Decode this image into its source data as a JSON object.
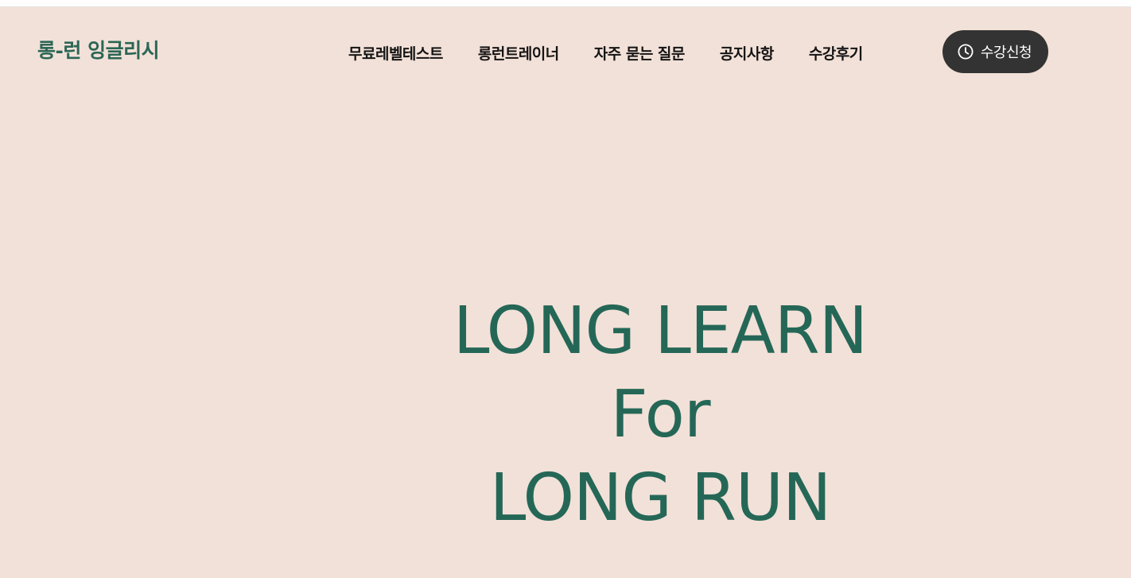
{
  "header": {
    "logo_text": "롱-런 잉글리시",
    "nav": [
      {
        "label": "무료레벨테스트"
      },
      {
        "label": "롱런트레이너"
      },
      {
        "label": "자주 묻는 질문"
      },
      {
        "label": "공지사항"
      },
      {
        "label": "수강후기"
      }
    ],
    "cta": {
      "label": "수강신청",
      "icon": "clock-icon"
    }
  },
  "hero": {
    "line1": "LONG LEARN",
    "line2": "For",
    "line3": "LONG RUN"
  },
  "colors": {
    "background": "#f2e1d8",
    "brand_green": "#256757",
    "cta_background": "#333333"
  }
}
